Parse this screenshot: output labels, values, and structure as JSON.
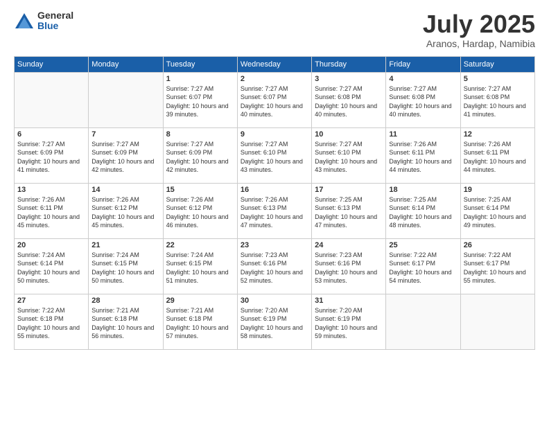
{
  "logo": {
    "general": "General",
    "blue": "Blue"
  },
  "title": "July 2025",
  "location": "Aranos, Hardap, Namibia",
  "days_of_week": [
    "Sunday",
    "Monday",
    "Tuesday",
    "Wednesday",
    "Thursday",
    "Friday",
    "Saturday"
  ],
  "weeks": [
    [
      {
        "day": "",
        "info": ""
      },
      {
        "day": "",
        "info": ""
      },
      {
        "day": "1",
        "sunrise": "7:27 AM",
        "sunset": "6:07 PM",
        "daylight": "10 hours and 39 minutes."
      },
      {
        "day": "2",
        "sunrise": "7:27 AM",
        "sunset": "6:07 PM",
        "daylight": "10 hours and 40 minutes."
      },
      {
        "day": "3",
        "sunrise": "7:27 AM",
        "sunset": "6:08 PM",
        "daylight": "10 hours and 40 minutes."
      },
      {
        "day": "4",
        "sunrise": "7:27 AM",
        "sunset": "6:08 PM",
        "daylight": "10 hours and 40 minutes."
      },
      {
        "day": "5",
        "sunrise": "7:27 AM",
        "sunset": "6:08 PM",
        "daylight": "10 hours and 41 minutes."
      }
    ],
    [
      {
        "day": "6",
        "sunrise": "7:27 AM",
        "sunset": "6:09 PM",
        "daylight": "10 hours and 41 minutes."
      },
      {
        "day": "7",
        "sunrise": "7:27 AM",
        "sunset": "6:09 PM",
        "daylight": "10 hours and 42 minutes."
      },
      {
        "day": "8",
        "sunrise": "7:27 AM",
        "sunset": "6:09 PM",
        "daylight": "10 hours and 42 minutes."
      },
      {
        "day": "9",
        "sunrise": "7:27 AM",
        "sunset": "6:10 PM",
        "daylight": "10 hours and 43 minutes."
      },
      {
        "day": "10",
        "sunrise": "7:27 AM",
        "sunset": "6:10 PM",
        "daylight": "10 hours and 43 minutes."
      },
      {
        "day": "11",
        "sunrise": "7:26 AM",
        "sunset": "6:11 PM",
        "daylight": "10 hours and 44 minutes."
      },
      {
        "day": "12",
        "sunrise": "7:26 AM",
        "sunset": "6:11 PM",
        "daylight": "10 hours and 44 minutes."
      }
    ],
    [
      {
        "day": "13",
        "sunrise": "7:26 AM",
        "sunset": "6:11 PM",
        "daylight": "10 hours and 45 minutes."
      },
      {
        "day": "14",
        "sunrise": "7:26 AM",
        "sunset": "6:12 PM",
        "daylight": "10 hours and 45 minutes."
      },
      {
        "day": "15",
        "sunrise": "7:26 AM",
        "sunset": "6:12 PM",
        "daylight": "10 hours and 46 minutes."
      },
      {
        "day": "16",
        "sunrise": "7:26 AM",
        "sunset": "6:13 PM",
        "daylight": "10 hours and 47 minutes."
      },
      {
        "day": "17",
        "sunrise": "7:25 AM",
        "sunset": "6:13 PM",
        "daylight": "10 hours and 47 minutes."
      },
      {
        "day": "18",
        "sunrise": "7:25 AM",
        "sunset": "6:14 PM",
        "daylight": "10 hours and 48 minutes."
      },
      {
        "day": "19",
        "sunrise": "7:25 AM",
        "sunset": "6:14 PM",
        "daylight": "10 hours and 49 minutes."
      }
    ],
    [
      {
        "day": "20",
        "sunrise": "7:24 AM",
        "sunset": "6:14 PM",
        "daylight": "10 hours and 50 minutes."
      },
      {
        "day": "21",
        "sunrise": "7:24 AM",
        "sunset": "6:15 PM",
        "daylight": "10 hours and 50 minutes."
      },
      {
        "day": "22",
        "sunrise": "7:24 AM",
        "sunset": "6:15 PM",
        "daylight": "10 hours and 51 minutes."
      },
      {
        "day": "23",
        "sunrise": "7:23 AM",
        "sunset": "6:16 PM",
        "daylight": "10 hours and 52 minutes."
      },
      {
        "day": "24",
        "sunrise": "7:23 AM",
        "sunset": "6:16 PM",
        "daylight": "10 hours and 53 minutes."
      },
      {
        "day": "25",
        "sunrise": "7:22 AM",
        "sunset": "6:17 PM",
        "daylight": "10 hours and 54 minutes."
      },
      {
        "day": "26",
        "sunrise": "7:22 AM",
        "sunset": "6:17 PM",
        "daylight": "10 hours and 55 minutes."
      }
    ],
    [
      {
        "day": "27",
        "sunrise": "7:22 AM",
        "sunset": "6:18 PM",
        "daylight": "10 hours and 55 minutes."
      },
      {
        "day": "28",
        "sunrise": "7:21 AM",
        "sunset": "6:18 PM",
        "daylight": "10 hours and 56 minutes."
      },
      {
        "day": "29",
        "sunrise": "7:21 AM",
        "sunset": "6:18 PM",
        "daylight": "10 hours and 57 minutes."
      },
      {
        "day": "30",
        "sunrise": "7:20 AM",
        "sunset": "6:19 PM",
        "daylight": "10 hours and 58 minutes."
      },
      {
        "day": "31",
        "sunrise": "7:20 AM",
        "sunset": "6:19 PM",
        "daylight": "10 hours and 59 minutes."
      },
      {
        "day": "",
        "info": ""
      },
      {
        "day": "",
        "info": ""
      }
    ]
  ]
}
